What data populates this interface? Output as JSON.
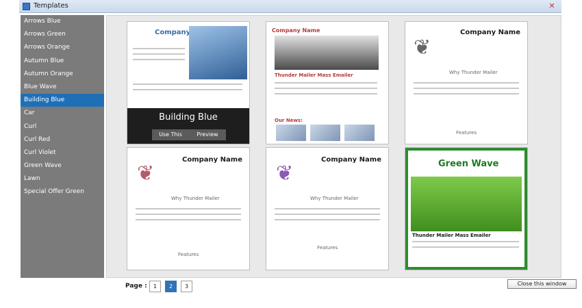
{
  "window": {
    "title": "Templates"
  },
  "sidebar": {
    "items": [
      {
        "label": "Arrows Blue"
      },
      {
        "label": "Arrows Green"
      },
      {
        "label": "Arrows Orange"
      },
      {
        "label": "Autumn Blue"
      },
      {
        "label": "Autumn Orange"
      },
      {
        "label": "Blue Wave"
      },
      {
        "label": "Building Blue"
      },
      {
        "label": "Car"
      },
      {
        "label": "Curl"
      },
      {
        "label": "Curl Red"
      },
      {
        "label": "Curl Violet"
      },
      {
        "label": "Green Wave"
      },
      {
        "label": "Lawn"
      },
      {
        "label": "Special Offer Green"
      }
    ],
    "active_index": 6
  },
  "grid": {
    "cards": [
      {
        "company": "Company Name",
        "overlay_title": "Building Blue",
        "use": "Use This",
        "preview": "Preview"
      },
      {
        "company": "Company Name",
        "heading": "Thunder Mailer Mass Emailer",
        "news": "Our News:"
      },
      {
        "company": "Company Name",
        "why": "Why Thunder Mailer",
        "features": "Features"
      },
      {
        "company": "Company Name",
        "why": "Why Thunder Mailer",
        "features": "Features"
      },
      {
        "company": "Company Name",
        "why": "Why Thunder Mailer",
        "features": "Features"
      },
      {
        "company": "Green Wave",
        "heading": "Thunder Mailer Mass Emailer"
      }
    ]
  },
  "pager": {
    "label": "Page :",
    "pages": [
      "1",
      "2",
      "3"
    ],
    "active_index": 1
  },
  "close_button": {
    "label": "Close this window"
  }
}
